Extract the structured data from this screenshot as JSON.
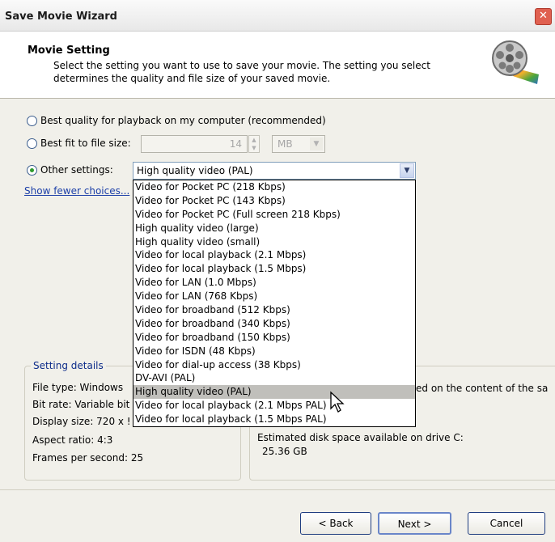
{
  "window": {
    "title": "Save Movie Wizard",
    "close_glyph": "✕"
  },
  "header": {
    "title": "Movie Setting",
    "description_line1": "Select the setting you want to use to save your movie. The setting you select",
    "description_line2": "determines the quality and file size of your saved movie.",
    "icon": "film-reel-icon"
  },
  "options": {
    "best_quality_label": "Best quality for playback on my computer (recommended)",
    "best_fit_label": "Best fit to file size:",
    "best_fit_value": "14",
    "best_fit_unit": "MB",
    "other_label": "Other settings:",
    "other_value": "High quality video (PAL)",
    "selected_option": "other"
  },
  "show_fewer_link": "Show fewer choices...",
  "dropdown": {
    "items": [
      "Video for Pocket PC (218 Kbps)",
      "Video for Pocket PC (143 Kbps)",
      "Video for Pocket PC (Full screen 218 Kbps)",
      "High quality video (large)",
      "High quality video (small)",
      "Video for local playback (2.1 Mbps)",
      "Video for local playback (1.5 Mbps)",
      "Video for LAN (1.0 Mbps)",
      "Video for LAN (768 Kbps)",
      "Video for broadband (512 Kbps)",
      "Video for broadband (340 Kbps)",
      "Video for broadband (150 Kbps)",
      "Video for ISDN (48 Kbps)",
      "Video for dial-up access (38 Kbps)",
      "DV-AVI (PAL)",
      "High quality video (PAL)",
      "Video for local playback (2.1 Mbps PAL)",
      "Video for local playback (1.5 Mbps PAL)"
    ],
    "highlighted": "High quality video (PAL)"
  },
  "details": {
    "legend": "Setting details",
    "file_type": "File type: Windows",
    "bit_rate": "Bit rate: Variable bit",
    "display_size": "Display size: 720 x !",
    "aspect_ratio": "Aspect ratio: 4:3",
    "fps": "Frames per second: 25"
  },
  "right_panel": {
    "partial_text": "ed on the content of the sa",
    "disk_label": "Estimated disk space available on drive C:",
    "disk_value": "25.36 GB"
  },
  "buttons": {
    "back": "< Back",
    "next": "Next >",
    "cancel": "Cancel"
  },
  "colors": {
    "link": "#1c3fa8",
    "legend": "#0d2c8a",
    "selected_row": "#c0bfbb",
    "close": "#e06050"
  }
}
